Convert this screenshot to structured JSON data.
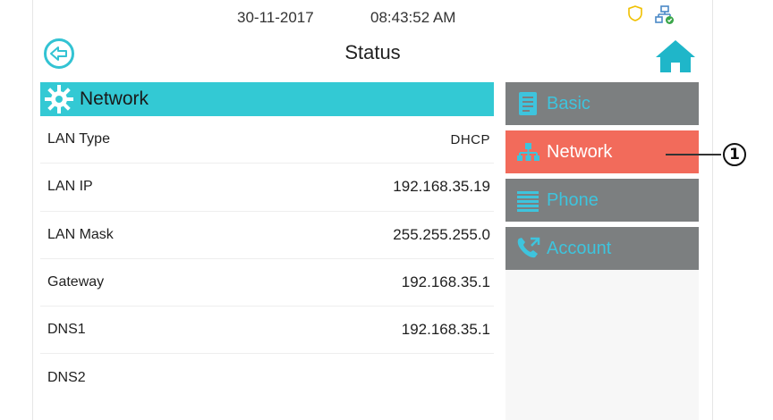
{
  "statusbar": {
    "date": "30-11-2017",
    "time": "08:43:52  AM"
  },
  "header": {
    "title": "Status"
  },
  "section": {
    "title": "Network"
  },
  "rows": [
    {
      "label": "LAN Type",
      "value": "DHCP"
    },
    {
      "label": "LAN IP",
      "value": "192.168.35.19"
    },
    {
      "label": "LAN Mask",
      "value": "255.255.255.0"
    },
    {
      "label": "Gateway",
      "value": "192.168.35.1"
    },
    {
      "label": "DNS1",
      "value": "192.168.35.1"
    },
    {
      "label": "DNS2",
      "value": ""
    }
  ],
  "tabs": [
    {
      "label": "Basic",
      "icon": "document-icon",
      "active": false
    },
    {
      "label": "Network",
      "icon": "network-icon",
      "active": true
    },
    {
      "label": "Phone",
      "icon": "list-icon",
      "active": false
    },
    {
      "label": "Account",
      "icon": "phone-account-icon",
      "active": false
    }
  ],
  "callout": {
    "number": "1"
  },
  "colors": {
    "accent": "#33c9d4",
    "active_tab": "#f26b5b",
    "tab": "#7c7f80",
    "home": "#1fb6c9"
  }
}
